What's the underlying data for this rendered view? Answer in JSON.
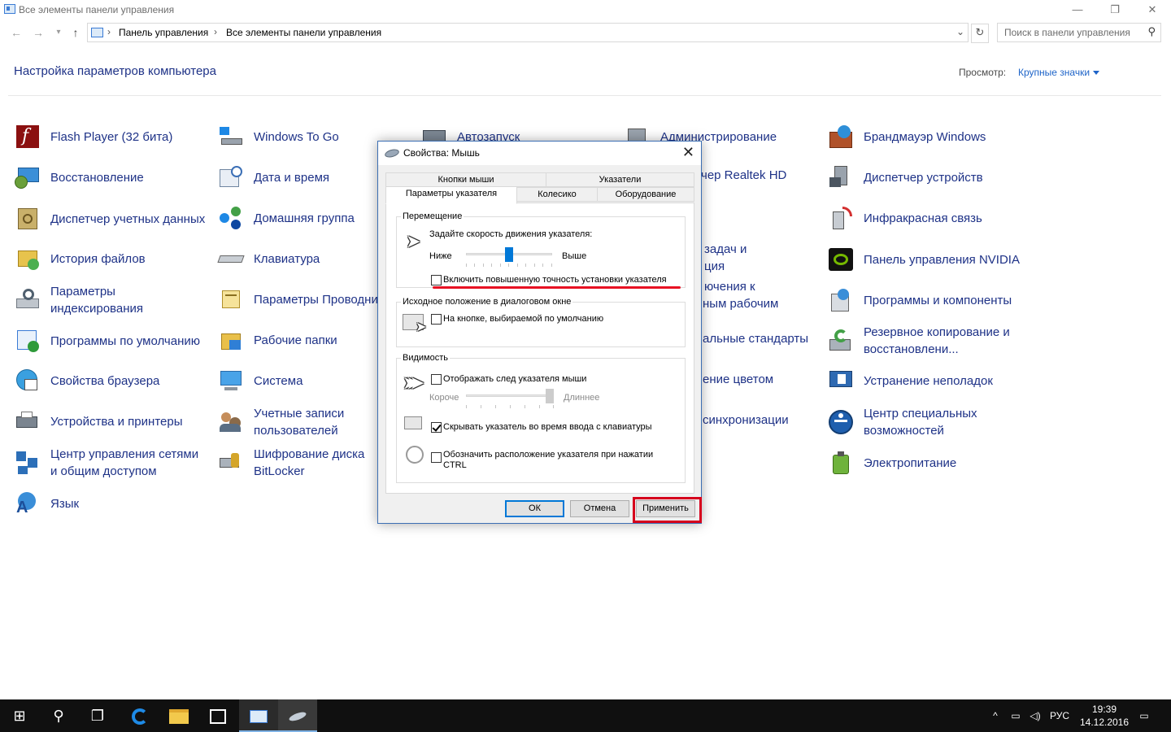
{
  "window": {
    "title": "Все элементы панели управления",
    "minimize": "—",
    "restore": "❐",
    "close": "✕"
  },
  "nav": {
    "back": "←",
    "forward": "→",
    "recent": "▾",
    "up": "↑",
    "breadcrumbs": [
      "Панель управления",
      "Все элементы панели управления"
    ],
    "refresh": "↻",
    "search_placeholder": "Поиск в панели управления"
  },
  "header": {
    "title": "Настройка параметров компьютера",
    "view_label": "Просмотр:",
    "view_value": "Крупные значки"
  },
  "items": {
    "col1": [
      {
        "name": "flash-player",
        "label": "Flash Player (32 бита)"
      },
      {
        "name": "recovery",
        "label": "Восстановление"
      },
      {
        "name": "credential-manager",
        "label": "Диспетчер учетных данных"
      },
      {
        "name": "file-history",
        "label": "История файлов"
      },
      {
        "name": "indexing-options",
        "label": "Параметры индексирования"
      },
      {
        "name": "default-programs",
        "label": "Программы по умолчанию"
      },
      {
        "name": "internet-options",
        "label": "Свойства браузера"
      },
      {
        "name": "devices-printers",
        "label": "Устройства и принтеры"
      },
      {
        "name": "network-center",
        "label": "Центр управления сетями и общим доступом"
      },
      {
        "name": "language",
        "label": "Язык"
      }
    ],
    "col2": [
      {
        "name": "windows-to-go",
        "label": "Windows To Go"
      },
      {
        "name": "date-time",
        "label": "Дата и время"
      },
      {
        "name": "homegroup",
        "label": "Домашняя группа"
      },
      {
        "name": "keyboard",
        "label": "Клавиатура"
      },
      {
        "name": "explorer-options",
        "label": "Параметры Проводника"
      },
      {
        "name": "work-folders",
        "label": "Рабочие папки"
      },
      {
        "name": "system",
        "label": "Система"
      },
      {
        "name": "user-accounts",
        "label": "Учетные записи пользователей"
      },
      {
        "name": "bitlocker",
        "label": "Шифрование диска BitLocker"
      }
    ],
    "col3_visible": [
      {
        "name": "autoplay",
        "label": "Автозапуск"
      }
    ],
    "col4": [
      {
        "name": "administration",
        "label": "Администрирование"
      },
      {
        "name": "realtek",
        "label": "чер Realtek HD"
      },
      {
        "name": "taskbar-nav-1",
        "label": "задач и"
      },
      {
        "name": "taskbar-nav-2",
        "label": "ция"
      },
      {
        "name": "connections-1",
        "label": "ючения к"
      },
      {
        "name": "connections-2",
        "label": "ным рабочим"
      },
      {
        "name": "regional",
        "label": "альные стандарты"
      },
      {
        "name": "color-mgmt",
        "label": "ение цветом"
      },
      {
        "name": "sync",
        "label": "синхронизации"
      }
    ],
    "col5": [
      {
        "name": "firewall",
        "label": "Брандмауэр Windows"
      },
      {
        "name": "device-manager",
        "label": "Диспетчер устройств"
      },
      {
        "name": "infrared",
        "label": "Инфракрасная связь"
      },
      {
        "name": "nvidia",
        "label": "Панель управления NVIDIA"
      },
      {
        "name": "programs-features",
        "label": "Программы и компоненты"
      },
      {
        "name": "backup",
        "label": "Резервное копирование и восстановлени..."
      },
      {
        "name": "troubleshooting",
        "label": "Устранение неполадок"
      },
      {
        "name": "ease-of-access",
        "label": "Центр специальных возможностей"
      },
      {
        "name": "power",
        "label": "Электропитание"
      }
    ]
  },
  "dialog": {
    "title": "Свойства: Мышь",
    "close": "✕",
    "tabs_top": [
      "Кнопки мыши",
      "Указатели"
    ],
    "tabs_bottom": [
      "Параметры указателя",
      "Колесико",
      "Оборудование"
    ],
    "motion": {
      "legend": "Перемещение",
      "speed_label": "Задайте скорость движения указателя:",
      "slow": "Ниже",
      "fast": "Выше",
      "speed_fraction": 0.5,
      "precision_label": "Включить повышенную точность установки указателя",
      "precision_checked": false
    },
    "snap": {
      "legend": "Исходное положение в диалоговом окне",
      "label": "На кнопке, выбираемой по умолчанию",
      "checked": false
    },
    "visibility": {
      "legend": "Видимость",
      "trails_label": "Отображать след указателя мыши",
      "trails_checked": false,
      "short": "Короче",
      "long": "Длиннее",
      "trails_fraction": 1.0,
      "hide_label": "Скрывать указатель во время ввода с клавиатуры",
      "hide_checked": true,
      "ctrl_label": "Обозначить расположение указателя при нажатии CTRL",
      "ctrl_checked": false
    },
    "buttons": {
      "ok": "ОК",
      "cancel": "Отмена",
      "apply": "Применить"
    }
  },
  "taskbar": {
    "start": "⊞",
    "search": "⚲",
    "task_view": "❐",
    "tray_chevron": "^",
    "language": "РУС",
    "time": "19:39",
    "date": "14.12.2016",
    "notifications": "▭"
  },
  "colors": {
    "link": "#1e3287",
    "accent": "#0078d7",
    "highlight_red": "#e81123"
  }
}
